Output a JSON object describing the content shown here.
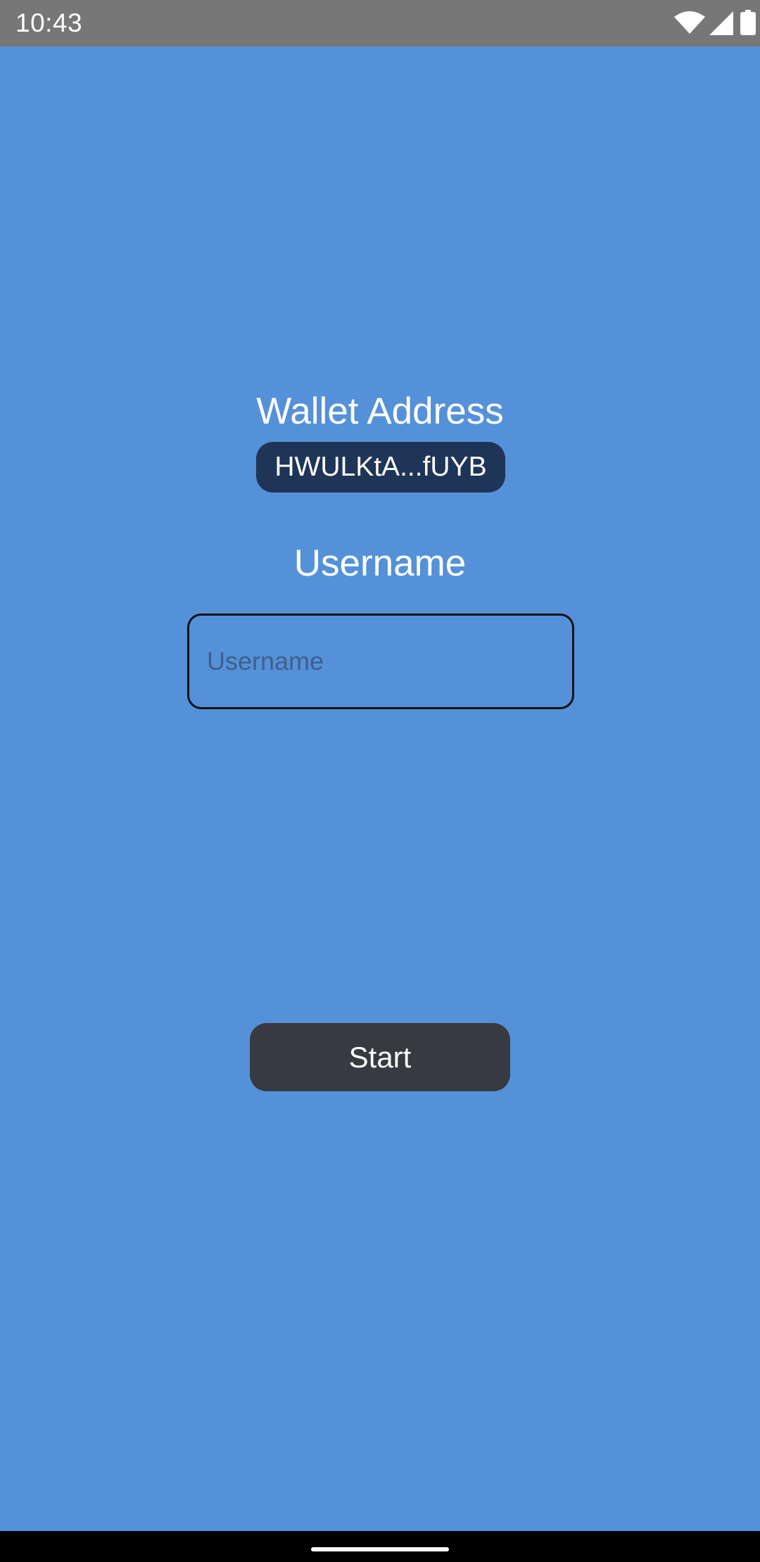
{
  "status_bar": {
    "time": "10:43",
    "icons": [
      "wifi-icon",
      "signal-icon",
      "battery-icon"
    ]
  },
  "wallet": {
    "title": "Wallet Address",
    "address": "HWULKtA...fUYB"
  },
  "username": {
    "title": "Username",
    "value": "",
    "placeholder": "Username"
  },
  "start_button": {
    "label": "Start"
  },
  "colors": {
    "background": "#5591d9",
    "status_bar": "#777777",
    "wallet_pill": "#1f3557",
    "button": "#373a40",
    "text": "#ffffff"
  }
}
